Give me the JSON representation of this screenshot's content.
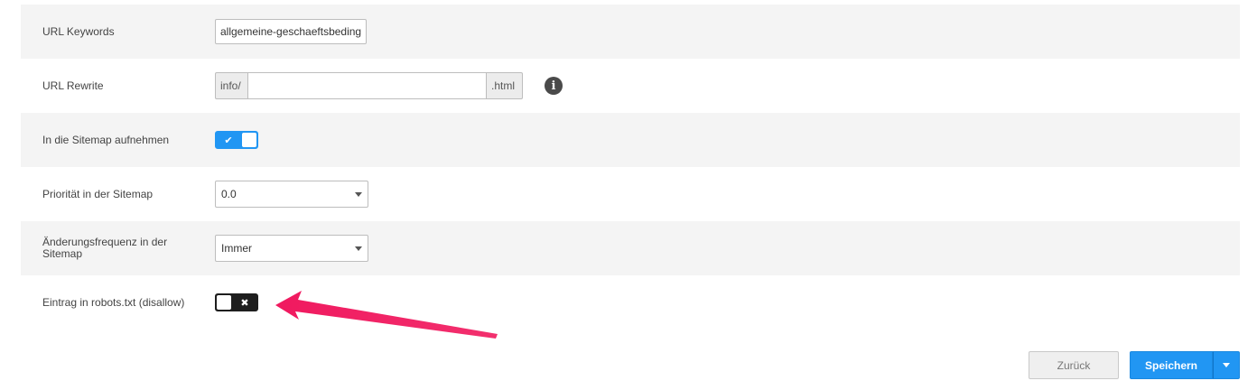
{
  "fields": {
    "url_keywords": {
      "label": "URL Keywords",
      "value": "allgemeine-geschaeftsbeding"
    },
    "url_rewrite": {
      "label": "URL Rewrite",
      "prefix": "info/",
      "value": "",
      "suffix": ".html",
      "icon": "info-icon"
    },
    "sitemap_include": {
      "label": "In die Sitemap aufnehmen",
      "state": "on",
      "icon": "check-icon"
    },
    "sitemap_priority": {
      "label": "Priorität in der Sitemap",
      "selected": "0.0"
    },
    "sitemap_frequency": {
      "label": "Änderungsfrequenz in der Sitemap",
      "selected": "Immer"
    },
    "robots_disallow": {
      "label": "Eintrag in robots.txt (disallow)",
      "state": "off",
      "icon": "x-icon"
    }
  },
  "buttons": {
    "back_label": "Zurück",
    "save_label": "Speichern"
  },
  "colors": {
    "primary": "#2196f3",
    "row_shade": "#f4f4f4",
    "annotation_arrow": "#f0195f",
    "toggle_off": "#1e1e1e"
  }
}
